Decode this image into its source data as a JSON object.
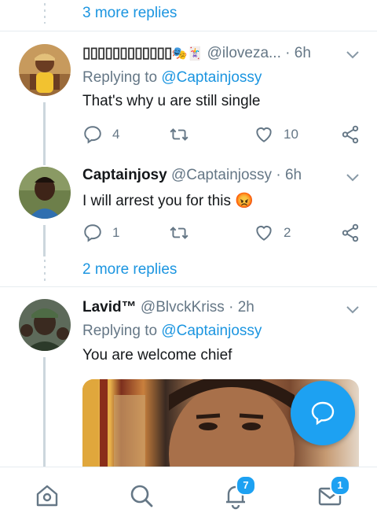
{
  "thread": {
    "more_replies_top": "3 more replies",
    "more_replies_mid": "2 more replies"
  },
  "tweets": [
    {
      "display_name": "▯▯▯▯▯▯▯▯▯▯▯▯",
      "emojis": "🎭🃏",
      "handle": "@iloveza...",
      "time": "· 6h",
      "replying_prefix": "Replying to",
      "replying_to": "@Captainjossy",
      "text": "That's why u are still single",
      "replies": "4",
      "retweets": "",
      "likes": "10"
    },
    {
      "display_name": "Captainjosy",
      "handle": "@Captainjossy",
      "time": "· 6h",
      "text": "I will arrest you for this",
      "text_emoji": "😡",
      "replies": "1",
      "retweets": "",
      "likes": "2"
    },
    {
      "display_name": "Lavid™",
      "handle": "@BlvckKriss",
      "time": "· 2h",
      "replying_prefix": "Replying to",
      "replying_to": "@Captainjossy",
      "text": "You are welcome chief"
    }
  ],
  "nav": {
    "notifications_badge": "7",
    "messages_badge": "1",
    "items": [
      "home-icon",
      "search-icon",
      "notifications-icon",
      "messages-icon"
    ]
  },
  "colors": {
    "accent": "#1da1f2",
    "link": "#1b95e0",
    "muted": "#657786"
  }
}
